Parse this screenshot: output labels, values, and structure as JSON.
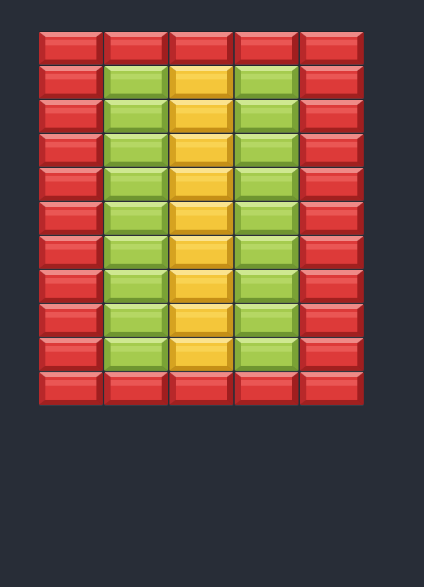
{
  "palette": {
    "red": {
      "top": "#ef8a87",
      "bot": "#a1201f",
      "lft": "#b8282a",
      "rgt": "#a01e1f",
      "face": "#dd3a39",
      "stripe": "#ea5654"
    },
    "green": {
      "top": "#cfe891",
      "bot": "#6f9530",
      "lft": "#86ad3a",
      "rgt": "#7aa235",
      "face": "#a5cb4e",
      "stripe": "#b5d764"
    },
    "yellow": {
      "top": "#fbe38e",
      "bot": "#c58f16",
      "lft": "#d6a320",
      "rgt": "#c9961b",
      "face": "#f4c63a",
      "stripe": "#f9d352"
    }
  },
  "board": {
    "rows": [
      [
        "red",
        "red",
        "red",
        "red",
        "red"
      ],
      [
        "red",
        "green",
        "yellow",
        "green",
        "red"
      ],
      [
        "red",
        "green",
        "yellow",
        "green",
        "red"
      ],
      [
        "red",
        "green",
        "yellow",
        "green",
        "red"
      ],
      [
        "red",
        "green",
        "yellow",
        "green",
        "red"
      ],
      [
        "red",
        "green",
        "yellow",
        "green",
        "red"
      ],
      [
        "red",
        "green",
        "yellow",
        "green",
        "red"
      ],
      [
        "red",
        "green",
        "yellow",
        "green",
        "red"
      ],
      [
        "red",
        "green",
        "yellow",
        "green",
        "red"
      ],
      [
        "red",
        "green",
        "yellow",
        "green",
        "red"
      ],
      [
        "red",
        "red",
        "red",
        "red",
        "red"
      ]
    ]
  }
}
